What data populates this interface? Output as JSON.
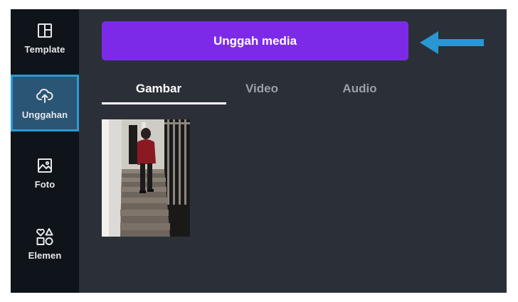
{
  "sidebar": {
    "items": [
      {
        "label": "Template",
        "icon": "template-icon"
      },
      {
        "label": "Unggahan",
        "icon": "cloud-upload-icon"
      },
      {
        "label": "Foto",
        "icon": "photo-icon"
      },
      {
        "label": "Elemen",
        "icon": "elements-icon"
      }
    ],
    "active": "Unggahan"
  },
  "upload_button": {
    "label": "Unggah media"
  },
  "tabs": [
    {
      "label": "Gambar",
      "active": true
    },
    {
      "label": "Video",
      "active": false
    },
    {
      "label": "Audio",
      "active": false
    }
  ],
  "colors": {
    "panel_bg": "#2b3038",
    "sidebar_bg": "#0f141a",
    "accent": "#7d2ae8",
    "highlight": "#2a9bd6"
  }
}
